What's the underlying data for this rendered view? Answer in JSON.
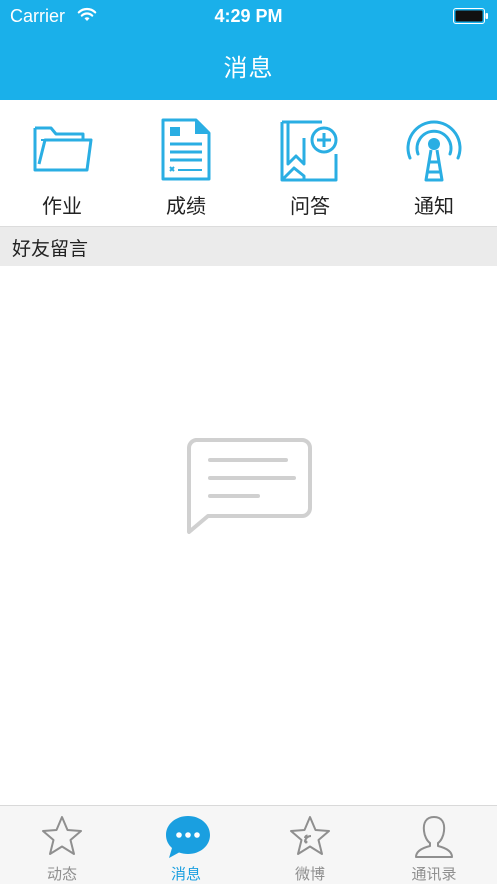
{
  "status_bar": {
    "carrier": "Carrier",
    "time": "4:29 PM"
  },
  "header": {
    "title": "消息"
  },
  "quick_actions": [
    {
      "label": "作业",
      "icon": "folder-icon"
    },
    {
      "label": "成绩",
      "icon": "document-icon"
    },
    {
      "label": "问答",
      "icon": "bookmark-add-icon"
    },
    {
      "label": "通知",
      "icon": "broadcast-tower-icon"
    }
  ],
  "section": {
    "title": "好友留言"
  },
  "empty_state": {
    "icon": "message-bubble-icon"
  },
  "tabbar": {
    "active_color": "#1a9fe0",
    "items": [
      {
        "label": "动态",
        "icon": "star-icon"
      },
      {
        "label": "消息",
        "icon": "chat-bubble-icon",
        "active": true
      },
      {
        "label": "微博",
        "icon": "weibo-star-icon"
      },
      {
        "label": "通讯录",
        "icon": "contact-person-icon"
      }
    ]
  },
  "colors": {
    "primary": "#1ab0ea",
    "section_bg": "#ebebeb",
    "icon_blue": "#2aaee3"
  }
}
